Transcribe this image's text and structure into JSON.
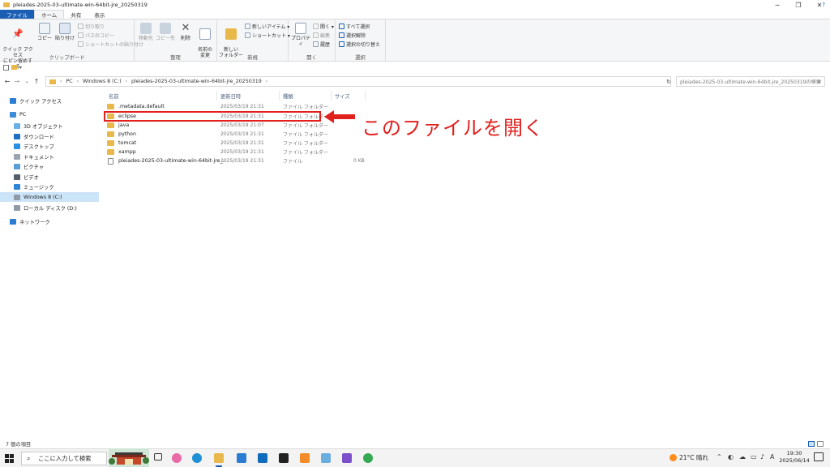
{
  "window": {
    "title": "pleiades-2025-03-ultimate-win-64bit-jre_20250319",
    "controls": {
      "minimize": "─",
      "maximize": "❐",
      "close": "✕"
    }
  },
  "ribbon_tabs": [
    "ファイル",
    "ホーム",
    "共有",
    "表示"
  ],
  "ribbon": {
    "clipboard": {
      "label": "クリップボード",
      "pin": "クイック アクセス\nにピン留めする",
      "copy": "コピー",
      "paste": "貼り付け",
      "cut": "切り取り",
      "copy_path": "パスのコピー",
      "paste_shortcut": "ショートカットの貼り付け"
    },
    "organize": {
      "label": "整理",
      "move_to": "移動先",
      "copy_to": "コピー先",
      "delete": "削除",
      "rename": "名前の\n変更"
    },
    "new": {
      "label": "新規",
      "new_folder": "新しい\nフォルダー",
      "new_item": "新しいアイテム ▾",
      "shortcut": "ショートカット ▾"
    },
    "open": {
      "label": "開く",
      "properties": "プロパティ",
      "open": "開く ▾",
      "edit": "編集",
      "history": "履歴"
    },
    "select": {
      "label": "選択",
      "select_all": "すべて選択",
      "select_none": "選択解除",
      "invert": "選択の切り替え"
    }
  },
  "qat": {
    "dropdown": "▾"
  },
  "nav_buttons": {
    "back": "←",
    "forward": "→",
    "recent": "⌄",
    "up": "↑"
  },
  "address": {
    "crumbs": [
      "PC",
      "Windows 8 (C:)",
      "pleiades-2025-03-ultimate-win-64bit-jre_20250319"
    ],
    "separator": "›",
    "refresh": "↻"
  },
  "search": {
    "placeholder": "pleiades-2025-03-ultimate-win-64bit-jre_20250319の検索",
    "icon": "⌕"
  },
  "nav_pane": [
    {
      "label": "クイック アクセス",
      "icon": "star-icon",
      "color": "#2b7cd3"
    },
    {
      "label": "PC",
      "icon": "pc-icon",
      "color": "#3c8dd8"
    },
    {
      "label": "3D オブジェクト",
      "icon": "cube-icon",
      "color": "#6ab0e8"
    },
    {
      "label": "ダウンロード",
      "icon": "download-icon",
      "color": "#1e6fc0"
    },
    {
      "label": "デスクトップ",
      "icon": "desktop-icon",
      "color": "#2b8fe0"
    },
    {
      "label": "ドキュメント",
      "icon": "document-icon",
      "color": "#9aa5b1"
    },
    {
      "label": "ピクチャ",
      "icon": "picture-icon",
      "color": "#5aa0d8"
    },
    {
      "label": "ビデオ",
      "icon": "video-icon",
      "color": "#555f6b"
    },
    {
      "label": "ミュージック",
      "icon": "music-icon",
      "color": "#2f86d6"
    },
    {
      "label": "Windows 8 (C:)",
      "icon": "drive-icon",
      "color": "#8f9aa6"
    },
    {
      "label": "ローカル ディスク (D:)",
      "icon": "drive-icon",
      "color": "#8f9aa6"
    },
    {
      "label": "ネットワーク",
      "icon": "network-icon",
      "color": "#2b7cd3"
    }
  ],
  "columns": {
    "name": "名前",
    "date": "更新日時",
    "type": "種類",
    "size": "サイズ",
    "sort": "⌃"
  },
  "files": [
    {
      "name": ".metadata.default",
      "date": "2025/03/19 21:31",
      "type": "ファイル フォルダー",
      "size": "",
      "kind": "folder"
    },
    {
      "name": "eclipse",
      "date": "2025/03/19 21:31",
      "type": "ファイル フォルダー",
      "size": "",
      "kind": "folder"
    },
    {
      "name": "java",
      "date": "2025/03/19 21:07",
      "type": "ファイル フォルダー",
      "size": "",
      "kind": "folder"
    },
    {
      "name": "python",
      "date": "2025/03/19 21:31",
      "type": "ファイル フォルダー",
      "size": "",
      "kind": "folder"
    },
    {
      "name": "tomcat",
      "date": "2025/03/19 21:31",
      "type": "ファイル フォルダー",
      "size": "",
      "kind": "folder"
    },
    {
      "name": "xampp",
      "date": "2025/03/19 21:31",
      "type": "ファイル フォルダー",
      "size": "",
      "kind": "folder"
    },
    {
      "name": "pleiades-2025-03-ultimate-win-64bit-jre_...",
      "date": "2025/03/19 21:31",
      "type": "ファイル",
      "size": "0 KB",
      "kind": "file"
    }
  ],
  "annotation": {
    "text": "このファイルを開く",
    "color": "#e0211e"
  },
  "status": {
    "items_count": "7 個の項目"
  },
  "taskbar": {
    "search_placeholder": "ここに入力して検索",
    "weather": "21°C 晴れ",
    "time": "19:30",
    "date": "2025/06/14"
  },
  "colors": {
    "accent": "#1a5fb4",
    "folder": "#e8b84a",
    "highlight": "#e0211e"
  }
}
